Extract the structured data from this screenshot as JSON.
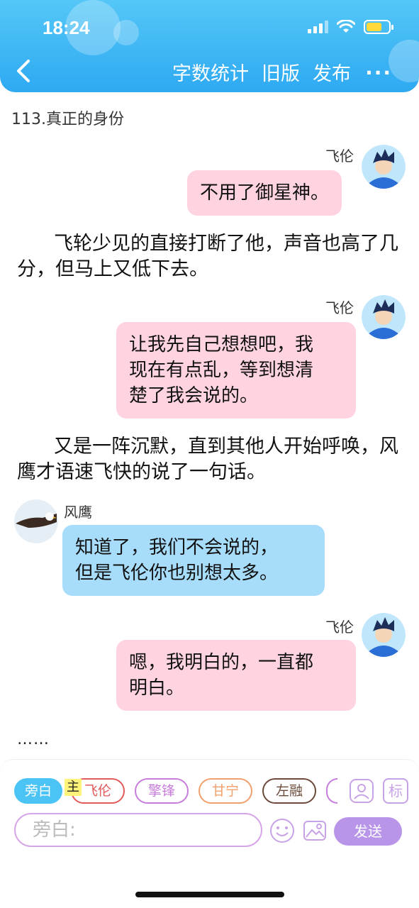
{
  "status": {
    "time": "18:24"
  },
  "header": {
    "actions": [
      "字数统计",
      "旧版",
      "发布"
    ],
    "more": "···"
  },
  "chapter_title": "113.真正的身份",
  "messages": [
    {
      "speaker": "飞伦",
      "text_lines": [
        "不用了御星神。"
      ]
    },
    {
      "speaker": "飞伦",
      "text_lines": [
        "让我先自己想想吧，我",
        "现在有点乱，等到想清",
        "楚了我会说的。"
      ]
    },
    {
      "speaker": "风鹰",
      "text_lines": [
        "知道了，我们不会说的，",
        "但是飞伦你也别想太多。"
      ]
    },
    {
      "speaker": "飞伦",
      "text_lines": [
        "嗯，我明白的，一直都",
        "明白。"
      ]
    }
  ],
  "narrations": [
    "飞轮少见的直接打断了他，声音也高了几分，但马上又低下去。",
    "又是一阵沉默，直到其他人开始呼唤，风鹰才语速飞快的说了一句话。"
  ],
  "ellipsis": "……",
  "composer": {
    "chips": [
      {
        "label": "旁白",
        "color": "#4cc3f5"
      },
      {
        "label": "飞伦",
        "color": "#e25a5a"
      },
      {
        "label": "擎锋",
        "color": "#c77ddc"
      },
      {
        "label": "甘宁",
        "color": "#f2a06b"
      },
      {
        "label": "左融",
        "color": "#6b4a3a"
      }
    ],
    "main_badge": "主",
    "label_button": "标",
    "input_placeholder": "旁白:",
    "send_label": "发送"
  }
}
